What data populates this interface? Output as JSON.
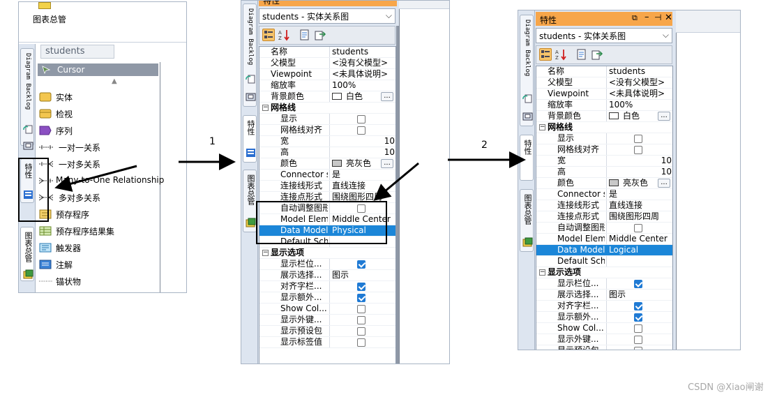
{
  "left_panel": {
    "top_item_label": "图表总管",
    "breadcrumb": "students",
    "cursor_label": "Cursor",
    "tabs": {
      "backlog": "Diagram Backlog",
      "properties": "特性",
      "diagram_manager": "图表总管"
    },
    "palette": [
      {
        "label": "实体",
        "icon": "entity-icon"
      },
      {
        "label": "检视",
        "icon": "view-icon"
      },
      {
        "label": "序列",
        "icon": "sequence-icon"
      },
      {
        "label": "一对一关系",
        "icon": "one-to-one-icon"
      },
      {
        "label": "一对多关系",
        "icon": "one-to-many-icon"
      },
      {
        "label": "Many-to-One Relationship",
        "icon": "many-to-one-icon"
      },
      {
        "label": "多对多关系",
        "icon": "many-to-many-icon"
      },
      {
        "label": "预存程序",
        "icon": "stored-procedure-icon"
      },
      {
        "label": "预存程序结果集",
        "icon": "result-set-icon"
      },
      {
        "label": "触发器",
        "icon": "trigger-icon"
      },
      {
        "label": "注解",
        "icon": "note-icon"
      },
      {
        "label": "锚状物",
        "icon": "anchor-icon"
      }
    ]
  },
  "middle_panel": {
    "title": "特性",
    "selector": "students - 实体关系图",
    "tabs": {
      "backlog": "Diagram Backlog",
      "properties": "特性",
      "diagram_manager": "图表总管"
    },
    "rows": [
      {
        "key": "名称",
        "value": "students"
      },
      {
        "key": "父模型",
        "value": "<没有父模型>"
      },
      {
        "key": "Viewpoint",
        "value": "<未具体说明>"
      },
      {
        "key": "缩放率",
        "value": "100%"
      },
      {
        "key": "背景颜色",
        "value": "白色"
      },
      {
        "key": "网格线",
        "category": true
      },
      {
        "key": "显示",
        "check": false
      },
      {
        "key": "网格线对齐",
        "check": false
      },
      {
        "key": "宽",
        "value": "10"
      },
      {
        "key": "高",
        "value": "10"
      },
      {
        "key": "颜色",
        "value": "亮灰色"
      },
      {
        "key": "Connector s...",
        "value": "是"
      },
      {
        "key": "连接线形式",
        "value": "直线连接"
      },
      {
        "key": "连接点形式",
        "value": "围绕图形四周"
      },
      {
        "key": "自动调整图形...",
        "check": false
      },
      {
        "key": "Model Eleme...",
        "value": "Middle Center"
      },
      {
        "key": "Data Model",
        "value": "Physical",
        "selected": true
      },
      {
        "key": "Default Sche...",
        "value": ""
      },
      {
        "key": "显示选项",
        "category": true
      },
      {
        "key": "显示栏位...",
        "check": true
      },
      {
        "key": "展示选择...",
        "value": "图示"
      },
      {
        "key": "对齐字栏...",
        "check": true
      },
      {
        "key": "显示额外...",
        "check": true
      },
      {
        "key": "Show Col...",
        "check": false
      },
      {
        "key": "显示外键...",
        "check": false
      },
      {
        "key": "显示预设包",
        "check": false
      },
      {
        "key": "显示标签值",
        "check": false
      }
    ]
  },
  "right_panel": {
    "title": "特性",
    "selector": "students - 实体关系图",
    "tabs": {
      "backlog": "Diagram Backlog",
      "properties": "特性",
      "diagram_manager": "图表总管"
    },
    "rows": [
      {
        "key": "名称",
        "value": "students"
      },
      {
        "key": "父模型",
        "value": "<没有父模型>"
      },
      {
        "key": "Viewpoint",
        "value": "<未具体说明>"
      },
      {
        "key": "缩放率",
        "value": "100%"
      },
      {
        "key": "背景颜色",
        "value": "白色"
      },
      {
        "key": "网格线",
        "category": true
      },
      {
        "key": "显示",
        "check": false
      },
      {
        "key": "网格线对齐",
        "check": false
      },
      {
        "key": "宽",
        "value": "10"
      },
      {
        "key": "高",
        "value": "10"
      },
      {
        "key": "颜色",
        "value": "亮灰色"
      },
      {
        "key": "Connector s...",
        "value": "是"
      },
      {
        "key": "连接线形式",
        "value": "直线连接"
      },
      {
        "key": "连接点形式",
        "value": "围绕图形四周"
      },
      {
        "key": "自动调整图形...",
        "check": false
      },
      {
        "key": "Model Eleme...",
        "value": "Middle Center"
      },
      {
        "key": "Data Model",
        "value": "Logical",
        "selected": true
      },
      {
        "key": "Default Sche...",
        "value": ""
      },
      {
        "key": "显示选项",
        "category": true
      },
      {
        "key": "显示栏位...",
        "check": true
      },
      {
        "key": "展示选择...",
        "value": "图示"
      },
      {
        "key": "对齐字栏...",
        "check": true
      },
      {
        "key": "显示额外...",
        "check": true
      },
      {
        "key": "Show Col...",
        "check": false
      },
      {
        "key": "显示外键...",
        "check": false
      },
      {
        "key": "显示预设包",
        "check": false
      }
    ]
  },
  "annotations": {
    "step1": "1",
    "step2": "2",
    "watermark": "CSDN @Xiao闸谢"
  },
  "colors": {
    "title_orange": "#f7a64a",
    "selection_blue": "#1b86d8",
    "checkbox_blue": "#1f7ad4",
    "cursor_green": "#5e8c4e"
  }
}
